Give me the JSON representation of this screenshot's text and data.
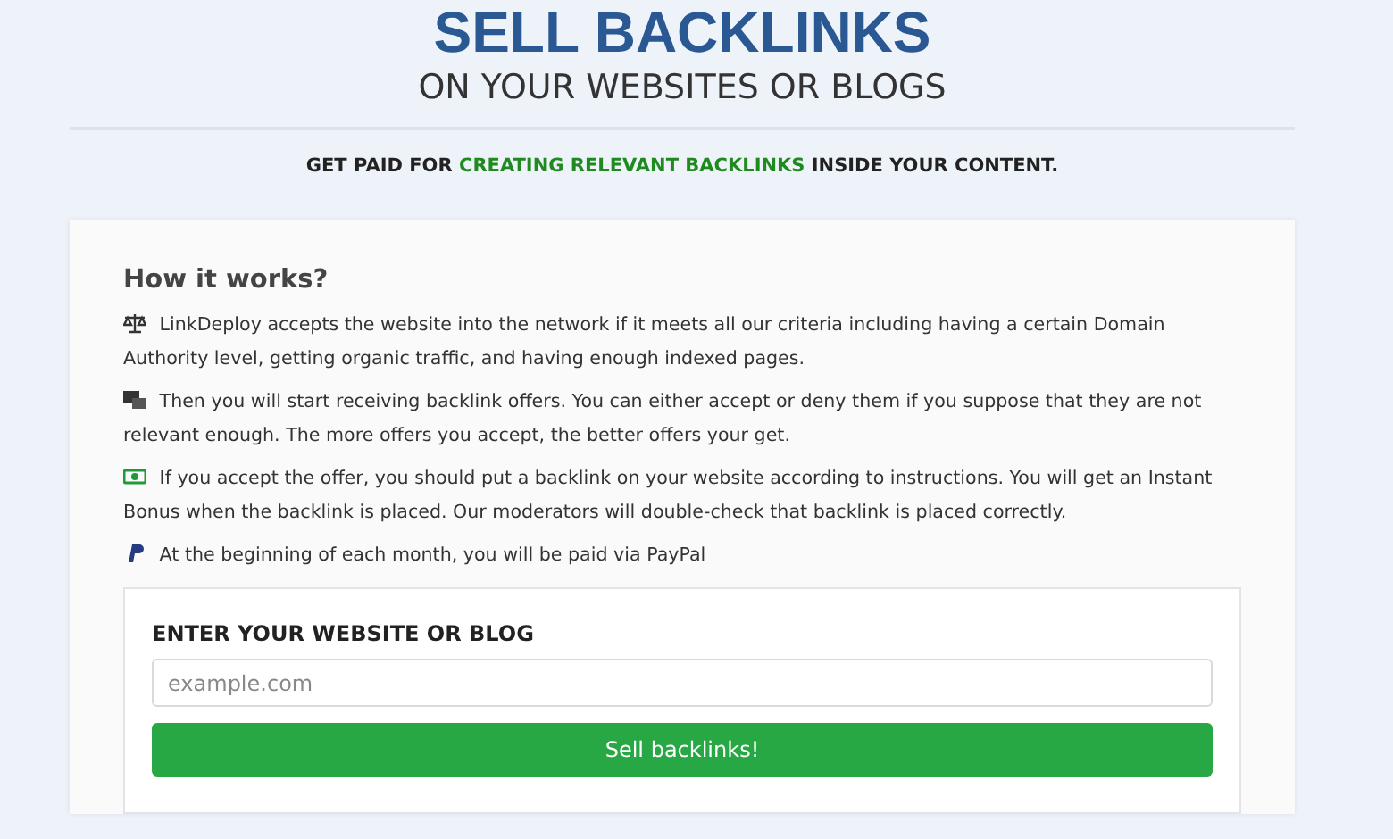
{
  "header": {
    "title": "SELL BACKLINKS",
    "subtitle": "ON YOUR WEBSITES OR BLOGS"
  },
  "tagline": {
    "before": "GET PAID FOR ",
    "highlight": "CREATING RELEVANT BACKLINKS",
    "after": " INSIDE YOUR CONTENT."
  },
  "how_it_works": {
    "heading": "How it works?",
    "steps": [
      {
        "kind": "scale",
        "text": "LinkDeploy accepts the website into the network if it meets all our criteria including having a certain Domain Authority level, getting organic traffic, and having enough indexed pages."
      },
      {
        "kind": "offers",
        "text": "Then you will start receiving backlink offers. You can either accept or deny them if you suppose that they are not relevant enough. The more offers you accept, the better offers your get."
      },
      {
        "kind": "deal",
        "text": "If you accept the offer, you should put a backlink on your website according to instructions. You will get an Instant Bonus when the backlink is placed. Our moderators will double-check that backlink is placed correctly."
      },
      {
        "kind": "paypal",
        "text": "At the beginning of each month, you will be paid via PayPal"
      }
    ]
  },
  "form": {
    "label": "ENTER YOUR WEBSITE OR BLOG",
    "placeholder": "example.com",
    "button": "Sell backlinks!"
  }
}
